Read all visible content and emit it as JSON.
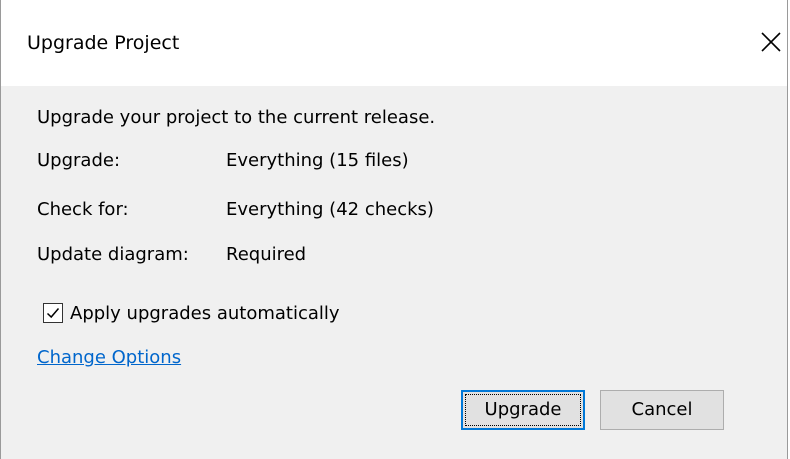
{
  "window": {
    "title": "Upgrade Project",
    "close_icon": "close-icon"
  },
  "dialog": {
    "intro": "Upgrade your project to the current release.",
    "details": [
      {
        "label": "Upgrade:",
        "value": "Everything (15 files)"
      },
      {
        "label": "Check for:",
        "value": "Everything (42 checks)"
      },
      {
        "label": "Update diagram:",
        "value": "Required"
      }
    ],
    "auto_apply": {
      "label": "Apply upgrades automatically",
      "checked": true
    },
    "change_options_link": "Change Options"
  },
  "buttons": {
    "upgrade": "Upgrade",
    "cancel": "Cancel"
  },
  "colors": {
    "link": "#0066cc",
    "default_button_border": "#0078d7",
    "content_background": "#f0f0f0"
  }
}
